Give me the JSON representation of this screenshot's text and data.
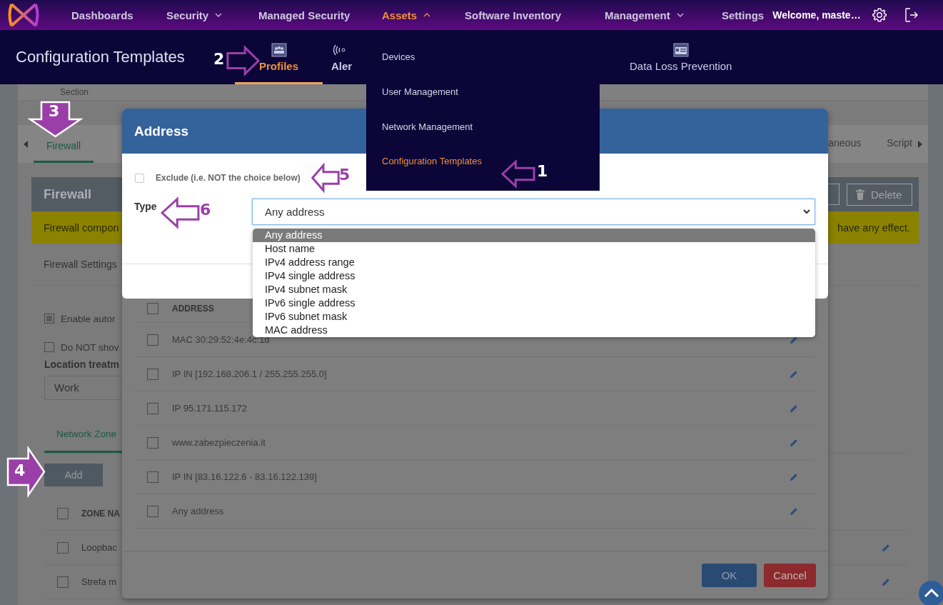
{
  "nav": {
    "items": [
      {
        "label": "Dashboards",
        "selected": false
      },
      {
        "label": "Security",
        "expanded": false,
        "selected": false
      },
      {
        "label": "Managed Security",
        "selected": false
      },
      {
        "label": "Assets",
        "expanded": true,
        "selected": true
      },
      {
        "label": "Software Inventory",
        "selected": false
      },
      {
        "label": "Management",
        "expanded": false,
        "selected": false
      },
      {
        "label": "Settings",
        "selected": false
      }
    ],
    "welcome": "Welcome, maste…"
  },
  "page_title": "Configuration Templates",
  "section_tabs": [
    {
      "label": "Profiles",
      "selected": true,
      "kind": "profiles"
    },
    {
      "label": "Aler",
      "selected": false,
      "kind": "alerts"
    },
    {
      "label": "Data Loss Prevention",
      "selected": false,
      "kind": "dlp"
    }
  ],
  "assets_menu": [
    {
      "label": "Devices",
      "selected": false
    },
    {
      "label": "User Management",
      "selected": false
    },
    {
      "label": "Network Management",
      "selected": false
    },
    {
      "label": "Configuration Templates",
      "selected": true
    }
  ],
  "toolbar": {
    "label": "Section"
  },
  "profile_tabs": [
    {
      "label": "Firewall",
      "selected": true
    },
    {
      "label": "aneous",
      "selected": false
    },
    {
      "label": "Script",
      "selected": false
    }
  ],
  "firewall_panel": {
    "title": "Firewall",
    "delete_button": "Delete",
    "notice_start": "Firewall compon",
    "notice_end": "have any effect.",
    "settings_label": "Firewall Settings",
    "options": [
      {
        "label": "Enable autor",
        "checked": true
      },
      {
        "label": "Do NOT shov",
        "checked": false
      }
    ],
    "location_label": "Location treatm",
    "location_value": "Work",
    "zones_tab": "Network Zone",
    "add_button": "Add",
    "zones_table": {
      "header_checked": false,
      "column_1": "ZONE NA",
      "rows": [
        {
          "name": "Loopbac",
          "checked": false
        },
        {
          "name": "Strefa m",
          "checked": false
        }
      ]
    }
  },
  "address_list_dialog": {
    "header_checked": false,
    "column": "ADDRESS",
    "rows": [
      {
        "address": "MAC 30:29:52:4e:4c:1d",
        "checked": false
      },
      {
        "address": "IP IN [192.168.206.1 / 255.255.255.0]",
        "checked": false
      },
      {
        "address": "IP 95.171.115.172",
        "checked": false
      },
      {
        "address": "www.zabezpieczenia.it",
        "checked": false
      },
      {
        "address": "IP IN [83.16.122.6 - 83.16.122.139]",
        "checked": false
      },
      {
        "address": "Any address",
        "checked": false
      }
    ],
    "ok": "OK",
    "cancel": "Cancel"
  },
  "address_dialog": {
    "title": "Address",
    "exclude": {
      "label": "Exclude (i.e. NOT the choice below)",
      "checked": false
    },
    "type_label": "Type",
    "type_value": "Any address",
    "options": [
      {
        "label": "Any address",
        "selected": true
      },
      {
        "label": "Host name",
        "selected": false
      },
      {
        "label": "IPv4 address range",
        "selected": false
      },
      {
        "label": "IPv4 single address",
        "selected": false
      },
      {
        "label": "IPv4 subnet mask",
        "selected": false
      },
      {
        "label": "IPv6 single address",
        "selected": false
      },
      {
        "label": "IPv6 subnet mask",
        "selected": false
      },
      {
        "label": "MAC address",
        "selected": false
      }
    ]
  },
  "annotations": [
    {
      "label": "1"
    },
    {
      "label": "2"
    },
    {
      "label": "3"
    },
    {
      "label": "4"
    },
    {
      "label": "5"
    },
    {
      "label": "6"
    }
  ]
}
